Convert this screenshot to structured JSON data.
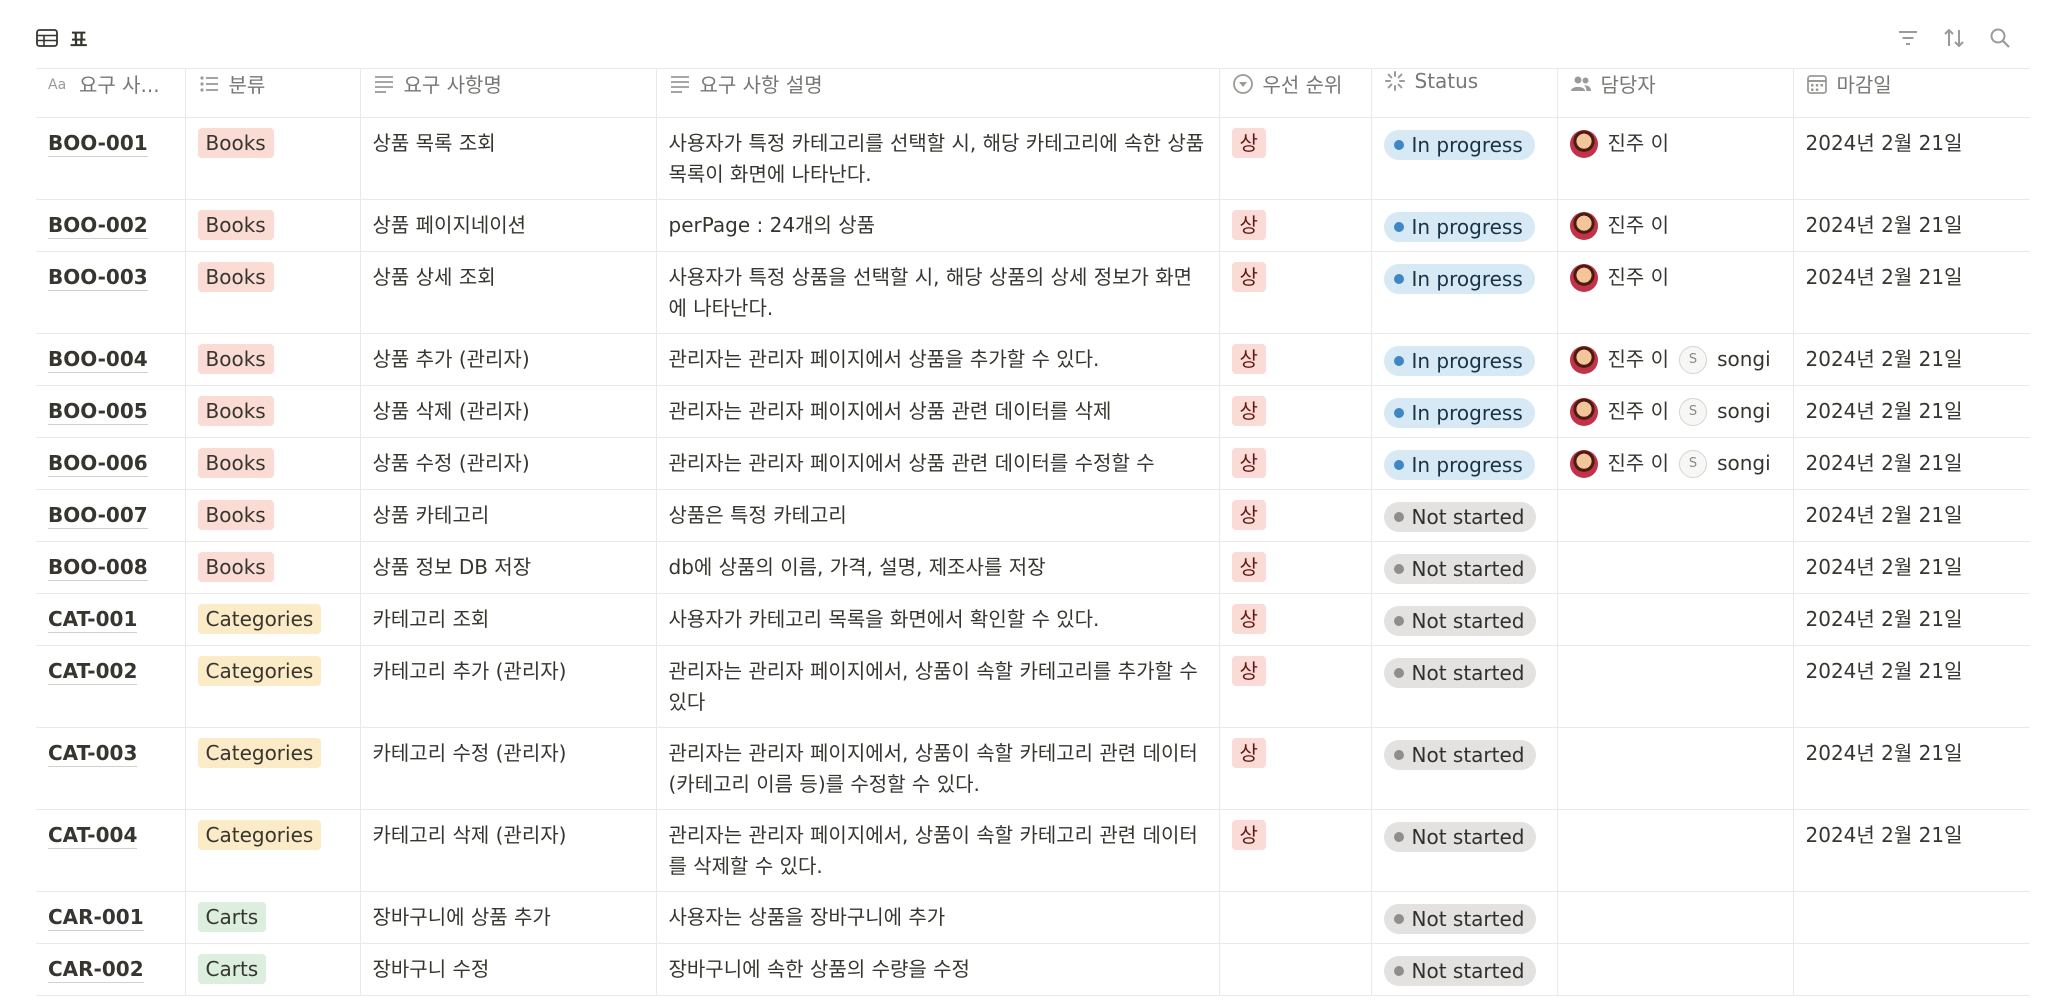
{
  "view": {
    "title": "표",
    "icon": "table-icon"
  },
  "toolbar": {
    "icons": [
      "filter-icon",
      "sort-icon",
      "search-icon"
    ]
  },
  "columns": [
    {
      "label": "요구 사...",
      "icon": "title-icon"
    },
    {
      "label": "분류",
      "icon": "multi-select-icon"
    },
    {
      "label": "요구 사항명",
      "icon": "text-icon"
    },
    {
      "label": "요구 사항 설명",
      "icon": "text-icon"
    },
    {
      "label": "우선 순위",
      "icon": "select-icon"
    },
    {
      "label": "Status",
      "icon": "status-icon"
    },
    {
      "label": "담당자",
      "icon": "person-icon"
    },
    {
      "label": "마감일",
      "icon": "calendar-icon"
    }
  ],
  "colors": {
    "books": "#fadcd5",
    "categories": "#fbecc7",
    "carts": "#dcefdf",
    "priority": "#fbdbd6",
    "in_progress": "#d6e9f5",
    "not_started": "#e3e2e0"
  },
  "rows": [
    {
      "id": "BOO-001",
      "category": "Books",
      "name": "상품 목록 조회",
      "desc": "사용자가 특정 카테고리를 선택할 시, 해당 카테고리에 속한 상품 목록이 화면에 나타난다.",
      "priority": "상",
      "status": "In progress",
      "assignees": [
        "진주 이"
      ],
      "due": "2024년 2월 21일"
    },
    {
      "id": "BOO-002",
      "category": "Books",
      "name": "상품 페이지네이션",
      "desc": "perPage : 24개의 상품",
      "priority": "상",
      "status": "In progress",
      "assignees": [
        "진주 이"
      ],
      "due": "2024년 2월 21일"
    },
    {
      "id": "BOO-003",
      "category": "Books",
      "name": "상품 상세 조회",
      "desc": "사용자가 특정 상품을 선택할 시, 해당 상품의 상세 정보가 화면에 나타난다.",
      "priority": "상",
      "status": "In progress",
      "assignees": [
        "진주 이"
      ],
      "due": "2024년 2월 21일"
    },
    {
      "id": "BOO-004",
      "category": "Books",
      "name": "상품 추가 (관리자)",
      "desc": "관리자는 관리자 페이지에서 상품을 추가할 수 있다.",
      "priority": "상",
      "status": "In progress",
      "assignees": [
        "진주 이",
        "songi"
      ],
      "due": "2024년 2월 21일"
    },
    {
      "id": "BOO-005",
      "category": "Books",
      "name": "상품 삭제 (관리자)",
      "desc": "관리자는 관리자 페이지에서 상품 관련 데이터를 삭제",
      "priority": "상",
      "status": "In progress",
      "assignees": [
        "진주 이",
        "songi"
      ],
      "due": "2024년 2월 21일"
    },
    {
      "id": "BOO-006",
      "category": "Books",
      "name": "상품 수정 (관리자)",
      "desc": "관리자는 관리자 페이지에서 상품 관련 데이터를 수정할 수",
      "priority": "상",
      "status": "In progress",
      "assignees": [
        "진주 이",
        "songi"
      ],
      "due": "2024년 2월 21일"
    },
    {
      "id": "BOO-007",
      "category": "Books",
      "name": "상품 카테고리",
      "desc": "상품은 특정 카테고리",
      "priority": "상",
      "status": "Not started",
      "assignees": [],
      "due": "2024년 2월 21일"
    },
    {
      "id": "BOO-008",
      "category": "Books",
      "name": "상품 정보 DB 저장",
      "desc": "db에 상품의 이름, 가격, 설명, 제조사를 저장",
      "priority": "상",
      "status": "Not started",
      "assignees": [],
      "due": "2024년 2월 21일"
    },
    {
      "id": "CAT-001",
      "category": "Categories",
      "name": "카테고리 조회",
      "desc": "사용자가 카테고리 목록을 화면에서 확인할 수 있다.",
      "priority": "상",
      "status": "Not started",
      "assignees": [],
      "due": "2024년 2월 21일"
    },
    {
      "id": "CAT-002",
      "category": "Categories",
      "name": "카테고리 추가 (관리자)",
      "desc": "관리자는 관리자 페이지에서, 상품이 속할 카테고리를 추가할 수 있다",
      "priority": "상",
      "status": "Not started",
      "assignees": [],
      "due": "2024년 2월 21일"
    },
    {
      "id": "CAT-003",
      "category": "Categories",
      "name": "카테고리 수정 (관리자)",
      "desc": "관리자는 관리자 페이지에서, 상품이 속할 카테고리 관련 데이터 (카테고리 이름 등)를 수정할 수 있다.",
      "priority": "상",
      "status": "Not started",
      "assignees": [],
      "due": "2024년 2월 21일"
    },
    {
      "id": "CAT-004",
      "category": "Categories",
      "name": "카테고리 삭제 (관리자)",
      "desc": "관리자는 관리자 페이지에서, 상품이 속할 카테고리 관련 데이터 를 삭제할 수 있다.",
      "priority": "상",
      "status": "Not started",
      "assignees": [],
      "due": "2024년 2월 21일"
    },
    {
      "id": "CAR-001",
      "category": "Carts",
      "name": "장바구니에 상품 추가",
      "desc": "사용자는 상품을 장바구니에 추가",
      "priority": "",
      "status": "Not started",
      "assignees": [],
      "due": ""
    },
    {
      "id": "CAR-002",
      "category": "Carts",
      "name": "장바구니 수정",
      "desc": "장바구니에 속한 상품의 수량을 수정",
      "priority": "",
      "status": "Not started",
      "assignees": [],
      "due": ""
    }
  ]
}
